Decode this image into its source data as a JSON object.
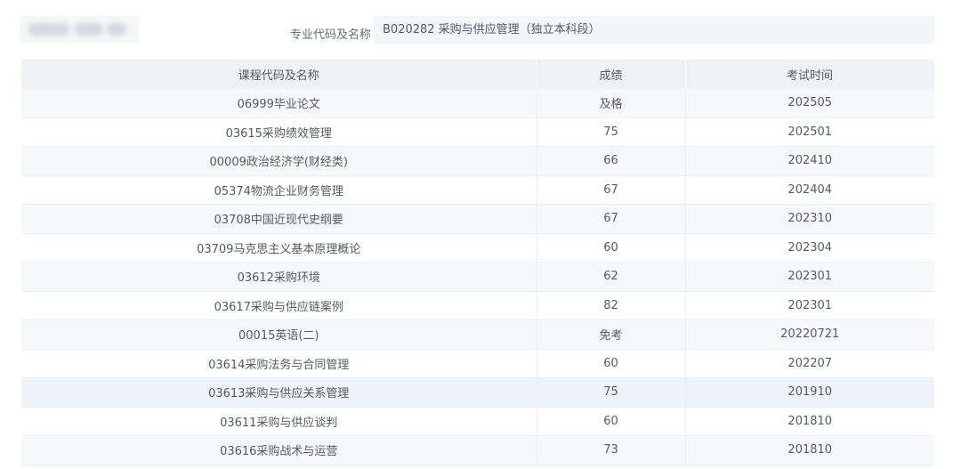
{
  "major": {
    "label": "专业代码及名称",
    "value": "B020282 采购与供应管理（独立本科段）"
  },
  "table": {
    "headers": [
      "课程代码及名称",
      "成绩",
      "考试时间"
    ],
    "rows": [
      [
        "06999毕业论文",
        "及格",
        "202505"
      ],
      [
        "03615采购绩效管理",
        "75",
        "202501"
      ],
      [
        "00009政治经济学(财经类)",
        "66",
        "202410"
      ],
      [
        "05374物流企业财务管理",
        "67",
        "202404"
      ],
      [
        "03708中国近现代史纲要",
        "67",
        "202310"
      ],
      [
        "03709马克思主义基本原理概论",
        "60",
        "202304"
      ],
      [
        "03612采购环境",
        "62",
        "202301"
      ],
      [
        "03617采购与供应链案例",
        "82",
        "202301"
      ],
      [
        "00015英语(二)",
        "免考",
        "20220721"
      ],
      [
        "03614采购法务与合同管理",
        "60",
        "202207"
      ],
      [
        "03613采购与供应关系管理",
        "75",
        "201910"
      ],
      [
        "03611采购与供应谈判",
        "60",
        "201810"
      ],
      [
        "03616采购战术与运营",
        "73",
        "201810"
      ]
    ]
  }
}
